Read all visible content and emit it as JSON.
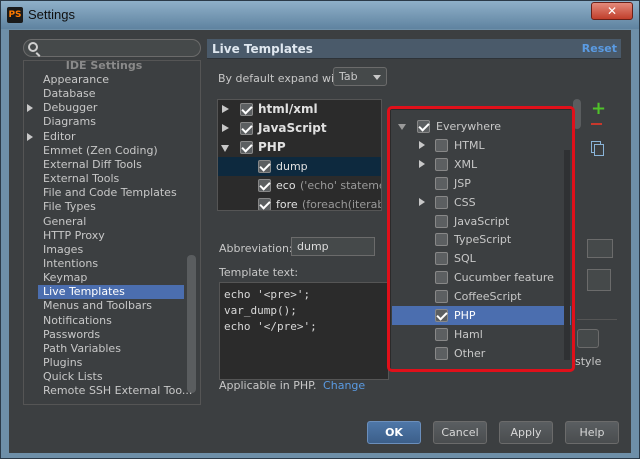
{
  "window": {
    "title": "Settings",
    "close_label": "✕",
    "logo_text": "PS"
  },
  "sidebar": {
    "header": "IDE Settings",
    "items": [
      {
        "label": "Appearance",
        "expandable": false
      },
      {
        "label": "Database",
        "expandable": false
      },
      {
        "label": "Debugger",
        "expandable": true
      },
      {
        "label": "Diagrams",
        "expandable": false
      },
      {
        "label": "Editor",
        "expandable": true
      },
      {
        "label": "Emmet (Zen Coding)",
        "expandable": false
      },
      {
        "label": "External Diff Tools",
        "expandable": false
      },
      {
        "label": "External Tools",
        "expandable": false
      },
      {
        "label": "File and Code Templates",
        "expandable": false
      },
      {
        "label": "File Types",
        "expandable": false
      },
      {
        "label": "General",
        "expandable": false
      },
      {
        "label": "HTTP Proxy",
        "expandable": false
      },
      {
        "label": "Images",
        "expandable": false
      },
      {
        "label": "Intentions",
        "expandable": false
      },
      {
        "label": "Keymap",
        "expandable": false
      },
      {
        "label": "Live Templates",
        "expandable": false,
        "selected": true
      },
      {
        "label": "Menus and Toolbars",
        "expandable": false
      },
      {
        "label": "Notifications",
        "expandable": false
      },
      {
        "label": "Passwords",
        "expandable": false
      },
      {
        "label": "Path Variables",
        "expandable": false
      },
      {
        "label": "Plugins",
        "expandable": false
      },
      {
        "label": "Quick Lists",
        "expandable": false
      },
      {
        "label": "Remote SSH External Too...",
        "expandable": false
      }
    ]
  },
  "panel": {
    "title": "Live Templates",
    "reset_label": "Reset",
    "expand_label": "By default expand with",
    "expand_value": "Tab",
    "groups": [
      {
        "name": "html/xml",
        "checked": true,
        "expanded": false
      },
      {
        "name": "JavaScript",
        "checked": true,
        "expanded": false
      },
      {
        "name": "PHP",
        "checked": true,
        "expanded": true
      }
    ],
    "templates": [
      {
        "abbr": "dump",
        "desc": "",
        "checked": true,
        "selected": true
      },
      {
        "abbr": "eco",
        "desc": "('echo' statement)",
        "checked": true
      },
      {
        "abbr": "fore",
        "desc": "(foreach(iterable_e",
        "checked": true
      }
    ],
    "abbreviation_label": "Abbreviation:",
    "abbreviation_value": "dump",
    "template_text_label": "Template text:",
    "template_text": "echo '<pre>';\nvar_dump();\necho '</pre>';",
    "applicable_text": "Applicable in PHP.",
    "change_label": "Change",
    "style_label": "style"
  },
  "context_popup": {
    "items": [
      {
        "label": "Everywhere",
        "level": 0,
        "checked": true,
        "expanded": true
      },
      {
        "label": "HTML",
        "level": 1,
        "checked": false,
        "expandable": true
      },
      {
        "label": "XML",
        "level": 1,
        "checked": false,
        "expandable": true
      },
      {
        "label": "JSP",
        "level": 1,
        "checked": false
      },
      {
        "label": "CSS",
        "level": 1,
        "checked": false,
        "expandable": true
      },
      {
        "label": "JavaScript",
        "level": 1,
        "checked": false
      },
      {
        "label": "TypeScript",
        "level": 1,
        "checked": false
      },
      {
        "label": "SQL",
        "level": 1,
        "checked": false
      },
      {
        "label": "Cucumber feature",
        "level": 1,
        "checked": false
      },
      {
        "label": "CoffeeScript",
        "level": 1,
        "checked": false
      },
      {
        "label": "PHP",
        "level": 1,
        "checked": true,
        "selected": true
      },
      {
        "label": "Haml",
        "level": 1,
        "checked": false
      },
      {
        "label": "Other",
        "level": 1,
        "checked": false
      }
    ]
  },
  "buttons": {
    "ok": "OK",
    "cancel": "Cancel",
    "apply": "Apply",
    "help": "Help"
  },
  "colors": {
    "highlight": "#e0101a",
    "selection": "#4b6eaf",
    "link": "#5a9be3"
  }
}
